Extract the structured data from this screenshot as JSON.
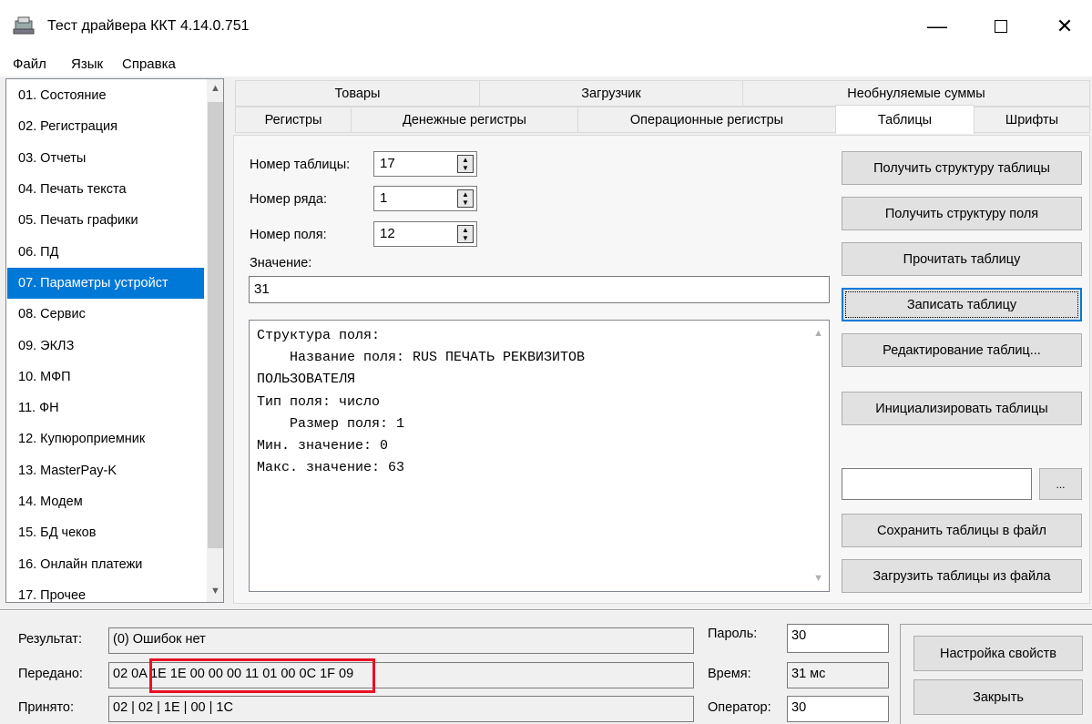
{
  "window": {
    "title": "Тест драйвера ККТ 4.14.0.751"
  },
  "menu": [
    "Файл",
    "Язык",
    "Справка"
  ],
  "sidebar": {
    "items": [
      "01. Состояние",
      "02. Регистрация",
      "03. Отчеты",
      "04. Печать текста",
      "05. Печать графики",
      "06. ПД",
      "07. Параметры устройст",
      "08. Сервис",
      "09. ЭКЛЗ",
      "10. МФП",
      "11. ФН",
      "12. Купюроприемник",
      "13. MasterPay-K",
      "14. Модем",
      "15. БД чеков",
      "16. Онлайн платежи",
      "17. Прочее"
    ],
    "selected_index": 6
  },
  "tabs_row1": [
    "Товары",
    "Загрузчик",
    "Необнуляемые суммы"
  ],
  "tabs_row2": [
    "Регистры",
    "Денежные регистры",
    "Операционные регистры",
    "Таблицы",
    "Шрифты"
  ],
  "active_tab": "Таблицы",
  "form": {
    "table_number_label": "Номер таблицы:",
    "table_number": "17",
    "row_number_label": "Номер ряда:",
    "row_number": "1",
    "field_number_label": "Номер поля:",
    "field_number": "12",
    "value_label": "Значение:",
    "value": "31"
  },
  "memo_lines": [
    "Структура поля:",
    "    Название поля: RUS ПЕЧАТЬ РЕКВИЗИТОВ",
    "ПОЛЬЗОВАТЕЛЯ",
    "Тип поля: число",
    "    Размер поля: 1",
    "Мин. значение: 0",
    "Макс. значение: 63"
  ],
  "buttons": {
    "get_table_structure": "Получить структуру таблицы",
    "get_field_structure": "Получить структуру поля",
    "read_table": "Прочитать таблицу",
    "write_table": "Записать таблицу",
    "edit_tables": "Редактирование таблиц...",
    "init_tables": "Инициализировать таблицы",
    "browse": "...",
    "save_tables": "Сохранить таблицы в файл",
    "load_tables": "Загрузить таблицы из файла",
    "settings": "Настройка свойств",
    "close": "Закрыть"
  },
  "status": {
    "result_label": "Результат:",
    "result": "(0) Ошибок нет",
    "sent_label": "Передано:",
    "sent": "02 0A 1E 1E 00 00 00 11 01 00 0C 1F 09",
    "received_label": "Принято:",
    "received": "02 | 02 | 1E | 00 | 1C",
    "password_label": "Пароль:",
    "password": "30",
    "time_label": "Время:",
    "time": "31 мс",
    "operator_label": "Оператор:",
    "operator": "30"
  },
  "colors": {
    "selection": "#0078d7",
    "highlight": "#e81123"
  }
}
